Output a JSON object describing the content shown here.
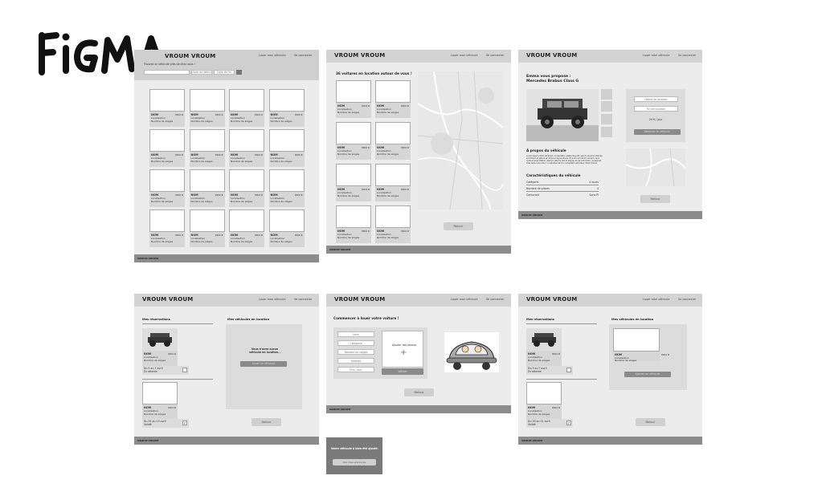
{
  "logo": {
    "text": "FIGMA"
  },
  "common": {
    "brand": "VROUM VROUM",
    "nav_rent": "Louer mon véhicule",
    "nav_login": "Se connecter",
    "footer": "VROUM VROUM",
    "back": "Retour",
    "card": {
      "name": "NOM",
      "price": "PRIX €",
      "location": "Localisation",
      "seats": "Nombre de sièges"
    }
  },
  "frame1": {
    "subtitle": "Trouvez un véhicule près de chez vous !",
    "search_placeholders": [
      "",
      "Date de début",
      "Date de fin"
    ]
  },
  "frame2": {
    "heading": "36 voitures en location autour de vous !"
  },
  "frame3": {
    "title_line1": "Emma vous propose :",
    "title_line2": "Mercedes Brabus Class G",
    "start": "Début de location",
    "end": "Fin de location",
    "price": "24 € / jour",
    "rent": "Réserver le véhicule",
    "about": "À propos du véhicule",
    "about_text": [
      "Lorem ipsum dolor sit amet, consectetur adipiscing elit, sed do eiusmod tempor",
      "incididunt ut labore et dolore magna aliqua. Ut enim ad minim veniam, quis",
      "nostrud exercitation ullamco laboris nisi ut aliquip ex ea commodo consequat.",
      "Duis aute irure dolor in reprehenderit in voluptate velit esse cillum dolore."
    ],
    "specs_title": "Caractéristiques du véhicule",
    "specs": [
      [
        "Catégorie",
        "4 roues"
      ],
      [
        "Nombre de places",
        "4"
      ],
      [
        "Carburant",
        "Sans Pl"
      ]
    ]
  },
  "frame4": {
    "reservations": "Mes réservations",
    "vehicles": "Mes véhicules en location",
    "res1_dates": "Du 5 au 7 avril",
    "res1_status": "En attente",
    "res2_dates": "Du 31 au 15 avril",
    "res2_status": "Validé",
    "empty1": "Vous n'avez aucun",
    "empty2": "véhicule en location...",
    "add": "Louer un véhicule"
  },
  "frame5": {
    "heading": "Commencer à louer votre voiture !",
    "fields": [
      "Nom",
      "Catégorie",
      "Nombre de sièges",
      "Adresse",
      "Prix / jour"
    ],
    "photos": "Ajouter des photos",
    "plus": "+",
    "submit": "Valider",
    "toast": "Votre véhicule à bien été ajouté.",
    "toast_btn": "Voir mes annonces"
  },
  "frame6": {
    "reservations": "Mes réservations",
    "vehicles": "Mes véhicules en location",
    "res1_loc": "Localisation",
    "res2_dates": "Du 29 au 31 avril",
    "add": "Ajouter un véhicule"
  }
}
